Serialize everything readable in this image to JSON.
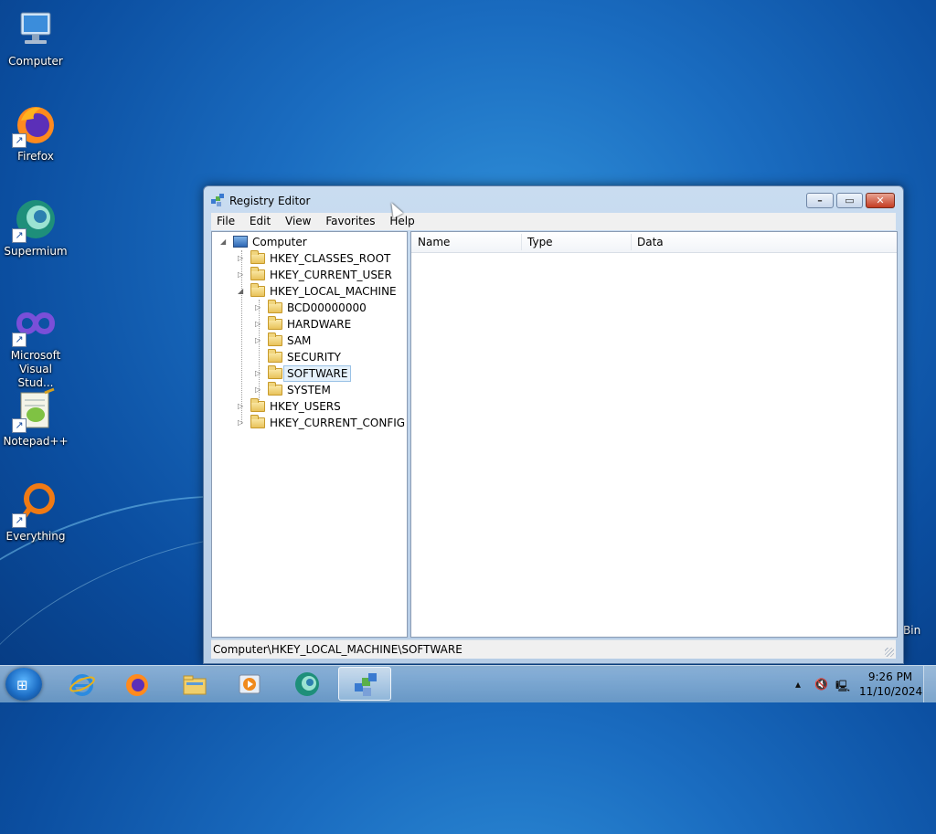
{
  "desktop": {
    "icons": [
      {
        "label": "Computer",
        "icon": "computer-icon"
      },
      {
        "label": "Firefox",
        "icon": "firefox-icon"
      },
      {
        "label": "Supermium",
        "icon": "supermium-icon"
      },
      {
        "label": "Microsoft Visual Stud...",
        "icon": "visual-studio-icon"
      },
      {
        "label": "Notepad++",
        "icon": "notepadpp-icon"
      },
      {
        "label": "Everything",
        "icon": "everything-icon"
      }
    ],
    "bin_label": "Bin"
  },
  "window": {
    "title": "Registry Editor",
    "menu": [
      "File",
      "Edit",
      "View",
      "Favorites",
      "Help"
    ],
    "tree": {
      "root": "Computer",
      "items": [
        {
          "label": "HKEY_CLASSES_ROOT",
          "level": 1,
          "expander": "▷"
        },
        {
          "label": "HKEY_CURRENT_USER",
          "level": 1,
          "expander": "▷"
        },
        {
          "label": "HKEY_LOCAL_MACHINE",
          "level": 1,
          "expander": "◢"
        },
        {
          "label": "BCD00000000",
          "level": 2,
          "expander": "▷"
        },
        {
          "label": "HARDWARE",
          "level": 2,
          "expander": "▷"
        },
        {
          "label": "SAM",
          "level": 2,
          "expander": "▷"
        },
        {
          "label": "SECURITY",
          "level": 2,
          "expander": ""
        },
        {
          "label": "SOFTWARE",
          "level": 2,
          "expander": "▷",
          "selected": true
        },
        {
          "label": "SYSTEM",
          "level": 2,
          "expander": "▷"
        },
        {
          "label": "HKEY_USERS",
          "level": 1,
          "expander": "▷"
        },
        {
          "label": "HKEY_CURRENT_CONFIG",
          "level": 1,
          "expander": "▷"
        }
      ]
    },
    "columns": [
      "Name",
      "Type",
      "Data"
    ],
    "status": "Computer\\HKEY_LOCAL_MACHINE\\SOFTWARE"
  },
  "taskbar": {
    "apps": [
      {
        "name": "Internet Explorer",
        "icon": "ie-icon"
      },
      {
        "name": "Firefox",
        "icon": "firefox-icon"
      },
      {
        "name": "Windows Explorer",
        "icon": "explorer-icon"
      },
      {
        "name": "Media Player",
        "icon": "media-player-icon"
      },
      {
        "name": "Supermium",
        "icon": "supermium-icon"
      },
      {
        "name": "Registry Editor",
        "icon": "regedit-icon",
        "active": true
      }
    ],
    "time": "9:26 PM",
    "date": "11/10/2024"
  }
}
